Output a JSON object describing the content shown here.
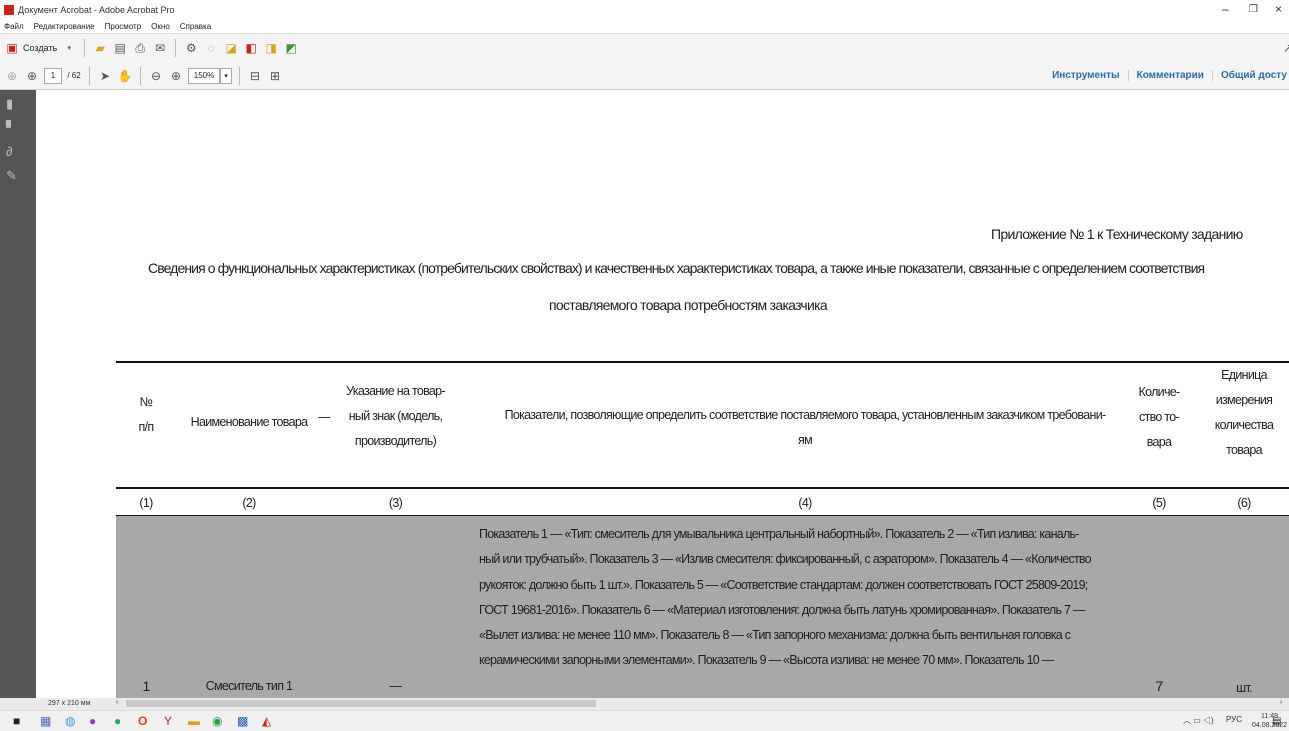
{
  "window": {
    "title": "Документ Acrobat - Adobe Acrobat Pro",
    "minimize": "–",
    "maximize": "❐",
    "close": "×"
  },
  "menu": [
    "Файл",
    "Редактирование",
    "Просмотр",
    "Окно",
    "Справка"
  ],
  "toolbar": {
    "create_label": "Создать",
    "page_current": "1",
    "page_total": "/ 62",
    "zoom": "150%",
    "tools_label": "Инструменты",
    "comments_label": "Комментарии",
    "share_label": "Общий досту"
  },
  "statusbar": {
    "page_size": "297 x 210 мм"
  },
  "document": {
    "appendix": "Приложение № 1 к Техническому заданию",
    "heading_line1": "Сведения о функциональных характеристиках (потребительских свойствах) и качественных характеристиках товара, а также иные показатели, связанные с определением соответствия",
    "heading_line2": "поставляемого товара потребностям заказчика",
    "table": {
      "headers": {
        "col1": [
          "№",
          "п/п"
        ],
        "col2": "Наименование товара",
        "col2_mark": "—",
        "col3": [
          "Указание на товар-",
          "ный знак (модель,",
          "производитель)"
        ],
        "col4": [
          "Показатели, позволяющие определить соответствие поставляемого товара, установленным заказчиком требовани-",
          "ям"
        ],
        "col5": [
          "Количе-",
          "ство то-",
          "вара"
        ],
        "col6": [
          "Единица",
          "измерения",
          "количества",
          "товара"
        ]
      },
      "numbering": [
        "(1)",
        "(2)",
        "(3)",
        "(4)",
        "(5)",
        "(6)"
      ],
      "row1": {
        "num": "1",
        "name": "Смеситель тип 1",
        "trademark": "—",
        "lines": [
          "Показатель 1 — «Тип: смеситель для умывальника центральный набортный». Показатель 2 — «Тип излива: каналь-",
          "ный или трубчатый». Показатель 3 — «Излив смесителя: фиксированный, с аэратором». Показатель 4 — «Количество",
          "рукояток: должно быть 1 шт.». Показатель 5 — «Соответствие стандартам: должен соответствовать ГОСТ 25809-2019;",
          "ГОСТ 19681-2016». Показатель 6 — «Материал изготовления: должна быть латунь хромированная». Показатель 7 —",
          "«Вылет излива: не менее 110 мм». Показатель 8 — «Тип запорного механизма: должна быть вентильная головка с",
          "керамическими запорными элементами». Показатель 9 — «Высота излива: не менее 70 мм». Показатель 10 —"
        ],
        "qty": "7",
        "unit": "шт."
      }
    }
  },
  "taskbar": {
    "lang": "РУС",
    "time": "11:48",
    "date": "04.08.2022"
  }
}
